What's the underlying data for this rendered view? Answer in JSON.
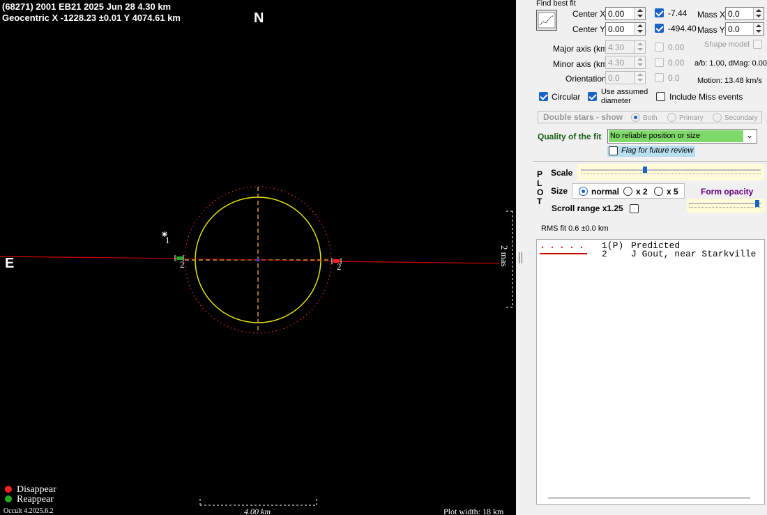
{
  "plot": {
    "header_line1": "(68271) 2001 EB21  2025 Jun 28   4.30 km",
    "header_line2": "Geocentric  X  -1228.23 ±0.01  Y 4074.61 km",
    "north_label": "N",
    "east_label": "E",
    "scale_right_label": "2 mas",
    "chord_label_1": "1",
    "chord_label_2a": "2",
    "chord_label_2b": "2",
    "legend_disappear": "Disappear",
    "legend_reappear": "Reappear",
    "version": "Occult 4.2025.6.2",
    "scale_bar_label": "4.00 km",
    "plot_width_label": "Plot width: 18 km",
    "colors": {
      "ellipse": "#e6e600",
      "predicted": "#ff2020",
      "chord": "#cc0000",
      "axes": "#e0a030",
      "disappear": "#ff2020",
      "reappear": "#22aa22"
    }
  },
  "panel": {
    "find_best_fit_label": "Find best fit",
    "center_x_label": "Center X",
    "center_x_value": "0.00",
    "center_y_label": "Center Y",
    "center_y_value": "0.00",
    "center_x_result": "-7.44",
    "center_y_result": "-494.40",
    "mass_x_label": "Mass X",
    "mass_x_value": "0.0",
    "mass_y_label": "Mass Y",
    "mass_y_value": "0.0",
    "major_axis_label": "Major axis (km)",
    "major_axis_value": "4.30",
    "major_axis_result": "0.00",
    "minor_axis_label": "Minor axis (km)",
    "minor_axis_value": "4.30",
    "minor_axis_result": "0.00",
    "orientation_label": "Orientation",
    "orientation_value": "0.0",
    "orientation_result": "0.0",
    "shape_model_label": "Shape model",
    "ab_dmag": "a/b: 1.00, dMag: 0.00",
    "motion": "Motion: 13.48 km/s",
    "circular_label": "Circular",
    "use_assumed_line1": "Use assumed",
    "use_assumed_line2": "diameter",
    "include_miss_label": "Include Miss events",
    "double_stars_label": "Double stars - show",
    "double_both": "Both",
    "double_primary": "Primary",
    "double_secondary": "Secondary",
    "quality_label": "Quality of the fit",
    "quality_value": "No reliable position or size",
    "flag_label": "Flag for future review",
    "plot_letters": [
      "P",
      "L",
      "O",
      "T"
    ],
    "scale_label": "Scale",
    "size_label": "Size",
    "size_normal": "normal",
    "size_x2": "x 2",
    "size_x5": "x 5",
    "form_opacity_label": "Form opacity",
    "scroll_range_label": "Scroll range x1.25",
    "rms_fit": "RMS fit 0.6 ±0.0 km",
    "legend_rows": [
      {
        "id": "1(P)",
        "name": "Predicted"
      },
      {
        "id": "2",
        "name": "J Gout, near Starkville"
      }
    ]
  }
}
